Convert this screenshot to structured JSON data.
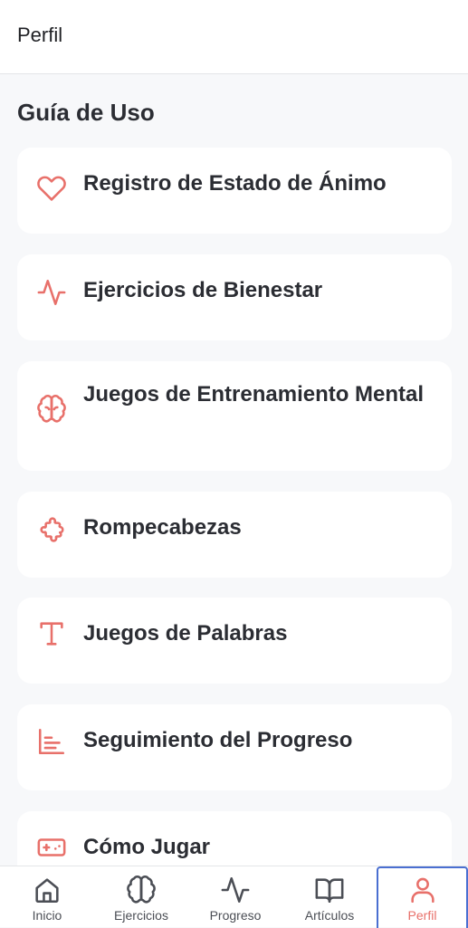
{
  "header": {
    "title": "Perfil"
  },
  "section": {
    "title": "Guía de Uso"
  },
  "colors": {
    "accent": "#e8706a",
    "tab_inactive": "#4b4e55",
    "focus_outline": "#4a6fd1"
  },
  "guide_items": [
    {
      "label": "Registro de Estado de Ánimo",
      "icon": "heart-icon"
    },
    {
      "label": "Ejercicios de Bienestar",
      "icon": "activity-icon"
    },
    {
      "label": "Juegos de Entrenamiento Mental",
      "icon": "brain-icon"
    },
    {
      "label": "Rompecabezas",
      "icon": "puzzle-icon"
    },
    {
      "label": "Juegos de Palabras",
      "icon": "text-type-icon"
    },
    {
      "label": "Seguimiento del Progreso",
      "icon": "bar-chart-icon"
    },
    {
      "label": "Cómo Jugar",
      "icon": "gamepad-icon"
    }
  ],
  "tabs": [
    {
      "label": "Inicio",
      "icon": "home-icon"
    },
    {
      "label": "Ejercicios",
      "icon": "brain-icon"
    },
    {
      "label": "Progreso",
      "icon": "activity-icon"
    },
    {
      "label": "Artículos",
      "icon": "book-icon"
    },
    {
      "label": "Perfil",
      "icon": "user-icon",
      "active": true
    }
  ]
}
